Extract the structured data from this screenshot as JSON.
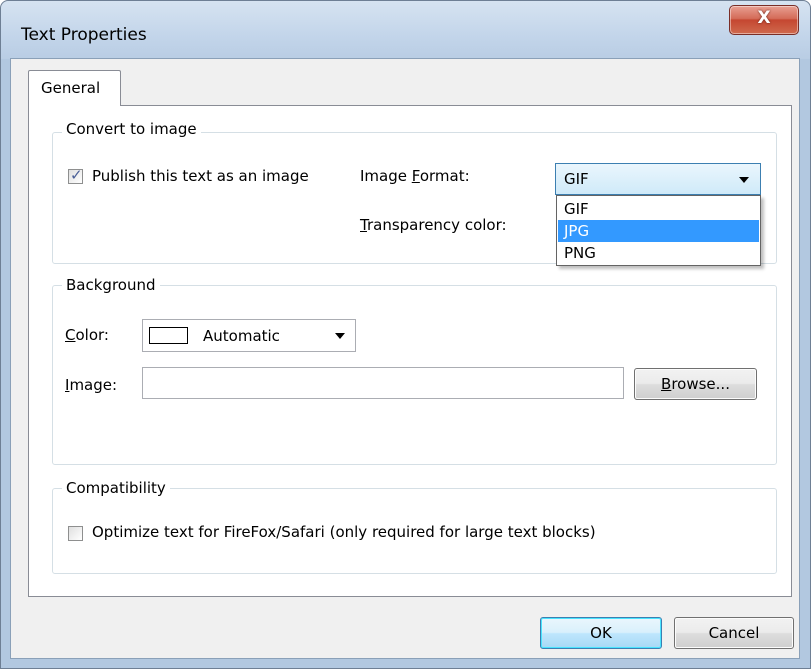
{
  "window": {
    "title": "Text Properties",
    "close_glyph": "X"
  },
  "tabs": [
    {
      "label": "General",
      "selected": true
    }
  ],
  "convert_group": {
    "label": "Convert to image",
    "publish_checkbox": {
      "label": "Publish this text as an image",
      "checked": true
    },
    "image_format": {
      "label_prefix": "Image ",
      "label_accel": "F",
      "label_suffix": "ormat:",
      "value": "GIF",
      "options": [
        "GIF",
        "JPG",
        "PNG"
      ],
      "highlighted": "JPG"
    },
    "transparency": {
      "label_accel": "T",
      "label_suffix": "ransparency color:"
    }
  },
  "background_group": {
    "label": "Background",
    "color": {
      "label_accel": "C",
      "label_suffix": "olor:",
      "value": "Automatic",
      "swatch": "#ffffff"
    },
    "image": {
      "label_accel": "I",
      "label_suffix": "mage:",
      "value": ""
    },
    "browse_button": {
      "accel": "B",
      "suffix": "rowse..."
    }
  },
  "compat_group": {
    "label": "Compatibility",
    "optimize_checkbox": {
      "label": "Optimize text for FireFox/Safari (only required for large text blocks)",
      "checked": false
    }
  },
  "footer": {
    "ok_label": "OK",
    "cancel_label": "Cancel"
  },
  "colors": {
    "selection": "#3399ff",
    "close_button": "#c54731"
  }
}
